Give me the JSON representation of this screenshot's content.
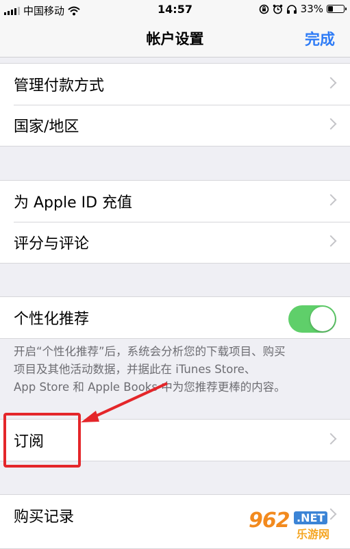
{
  "status_bar": {
    "carrier": "中国移动",
    "time": "14:57",
    "battery_percent": "33%",
    "battery_level": 0.33
  },
  "nav": {
    "title": "帐户设置",
    "done_label": "完成"
  },
  "groups": {
    "payment": {
      "manage_payment": "管理付款方式",
      "country_region": "国家/地区"
    },
    "apple_id": {
      "top_up": "为 Apple ID 充值",
      "ratings": "评分与评论"
    },
    "personalization": {
      "label": "个性化推荐",
      "enabled": true,
      "footnote_line1": "开启“个性化推荐”后，系统会分析您的下载项目、购买",
      "footnote_line2": "项目及其他活动数据，并据此在 iTunes Store、",
      "footnote_line3": "App Store 和 Apple Books 中为您推荐更棒的内容。"
    },
    "subscriptions": {
      "label": "订阅"
    },
    "purchases": {
      "label": "购买记录"
    }
  },
  "watermark": {
    "number": "962",
    "tld": ".NET",
    "site": "乐游网"
  },
  "colors": {
    "accent": "#2f7cf6",
    "toggle_on": "#5fcf6a",
    "highlight": "#e4262a",
    "background": "#efeff4"
  }
}
